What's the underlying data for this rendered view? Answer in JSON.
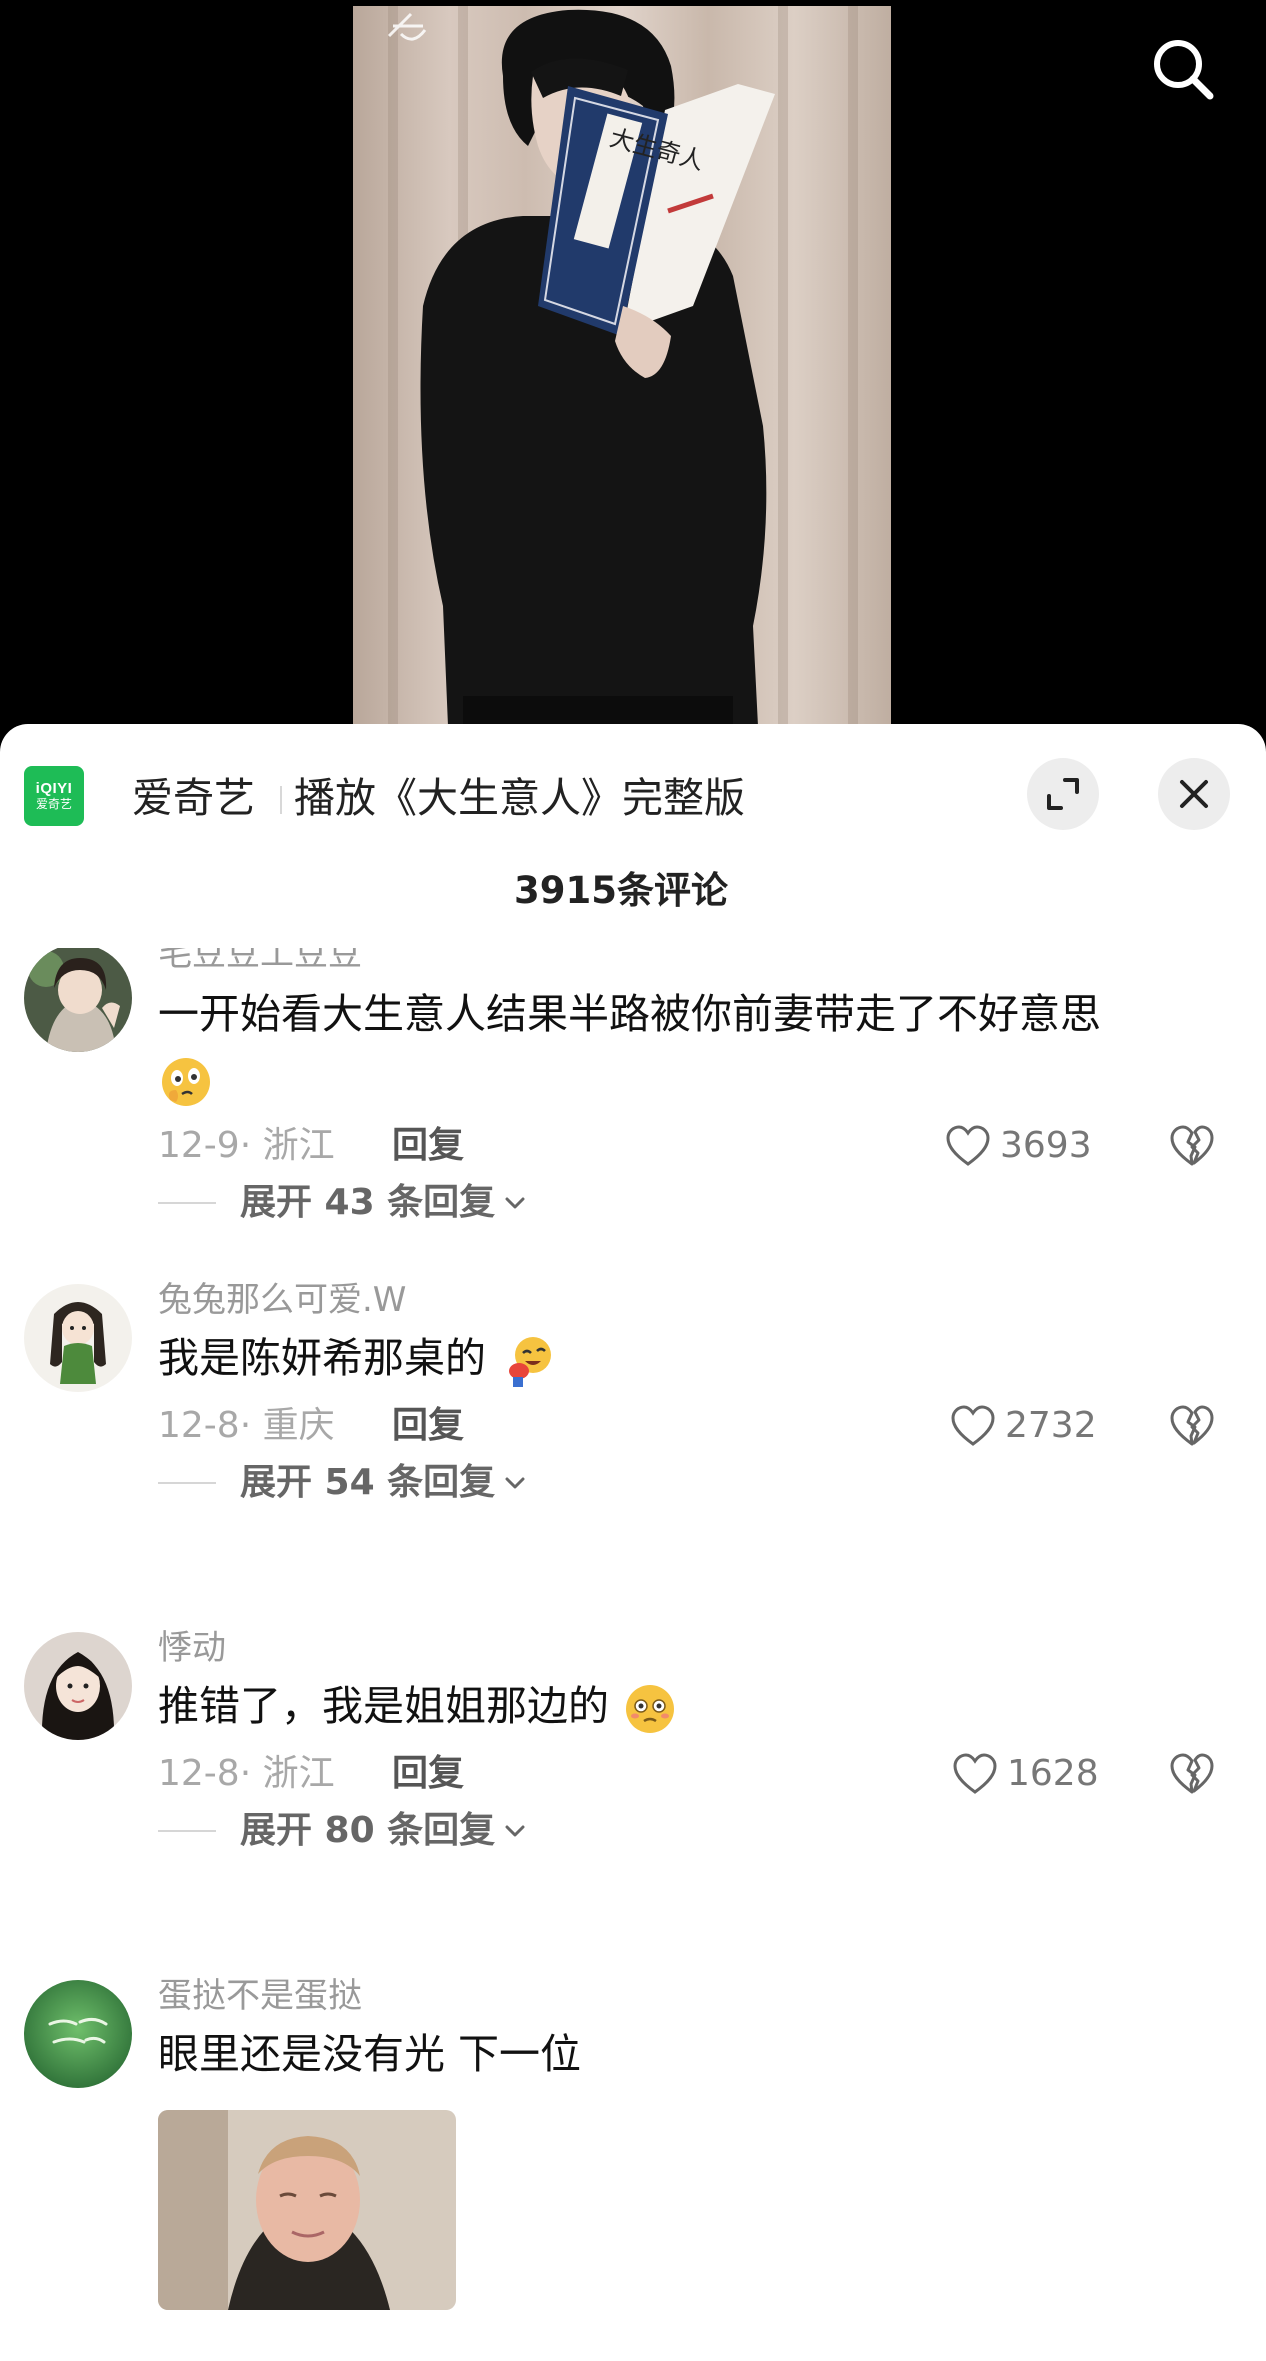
{
  "app": {
    "logo_line1": "iQIYI",
    "logo_line2": "爱奇艺",
    "name": "爱奇艺",
    "play_text": "播放《大生意人》完整版"
  },
  "video": {
    "book_title": "大生奇人"
  },
  "icons": {
    "search": "search-icon",
    "expand": "expand-icon",
    "close": "close-icon",
    "like": "heart-icon",
    "dislike": "broken-heart-icon",
    "expand_chevron": "chevron-down-icon"
  },
  "colors": {
    "brand_green": "#1ebc56",
    "panel_bg": "#ffffff",
    "meta_gray": "#a8a8a8"
  },
  "comments_header": {
    "count_text": "3915条评论"
  },
  "comments": [
    {
      "username": "毛豆豆工豆豆",
      "text": "一开始看大生意人结果半路被你前妻带走了不好意思",
      "date_location": "12-9· 浙江",
      "reply_label": "回复",
      "likes": "3693",
      "expand_label": "展开 43 条回复"
    },
    {
      "username": "兔兔那么可爱.W",
      "text": "我是陈妍希那桌的",
      "date_location": "12-8· 重庆",
      "reply_label": "回复",
      "likes": "2732",
      "expand_label": "展开 54 条回复"
    },
    {
      "username": "悸动",
      "text": "推错了，我是姐姐那边的",
      "date_location": "12-8· 浙江",
      "reply_label": "回复",
      "likes": "1628",
      "expand_label": "展开 80 条回复"
    },
    {
      "username": "蛋挞不是蛋挞",
      "text": "眼里还是没有光 下一位"
    }
  ]
}
